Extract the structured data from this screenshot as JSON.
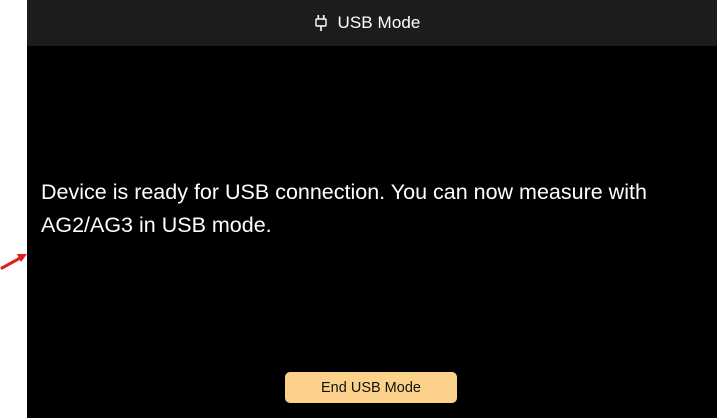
{
  "header": {
    "title": "USB Mode",
    "icon": "usb-plug-icon"
  },
  "main": {
    "message": "Device is ready for USB connection. You can now measure with AG2/AG3 in USB mode."
  },
  "actions": {
    "end_usb_label": "End USB Mode"
  },
  "colors": {
    "screen_background": "#000000",
    "title_bar_background": "#1c1c1c",
    "button_background": "#fcd28a",
    "annotation_arrow": "#e0211b"
  }
}
